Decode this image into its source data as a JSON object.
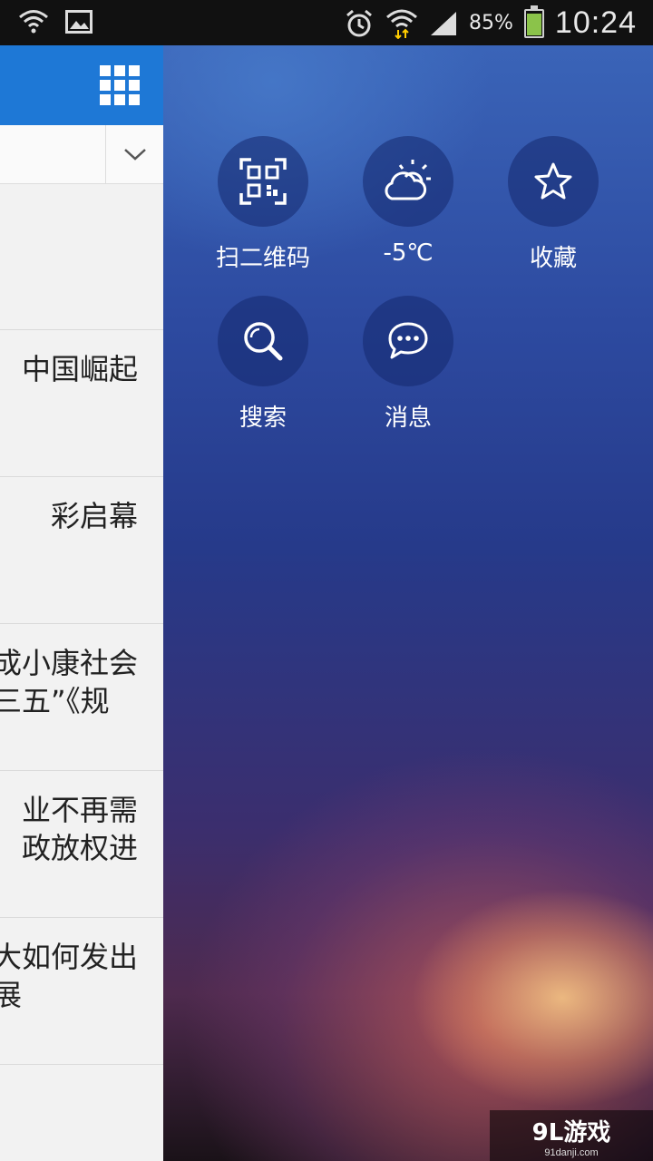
{
  "status_bar": {
    "icons_left": [
      "wifi-question-icon",
      "image-icon"
    ],
    "icons_right": [
      "alarm-icon",
      "wifi-icon",
      "signal-icon"
    ],
    "battery_percent": "85%",
    "battery_level": 0.85,
    "time": "10:24"
  },
  "news": {
    "items": [
      {
        "title": ""
      },
      {
        "title": "中国崛起"
      },
      {
        "title": "彩启幕"
      },
      {
        "title": "成小康社会\n三五”《规"
      },
      {
        "title": "业不再需\n政放权进"
      },
      {
        "title": "大如何发出\n展"
      }
    ]
  },
  "drawer": {
    "tiles": [
      {
        "label": "扫二维码",
        "icon": "qr-code-icon"
      },
      {
        "label": "-5℃",
        "icon": "weather-cloud-sun-icon"
      },
      {
        "label": "收藏",
        "icon": "star-icon"
      },
      {
        "label": "搜索",
        "icon": "search-icon"
      },
      {
        "label": "消息",
        "icon": "message-icon"
      }
    ]
  },
  "watermark": {
    "main": "9L游戏",
    "sub": "91danji.com"
  }
}
